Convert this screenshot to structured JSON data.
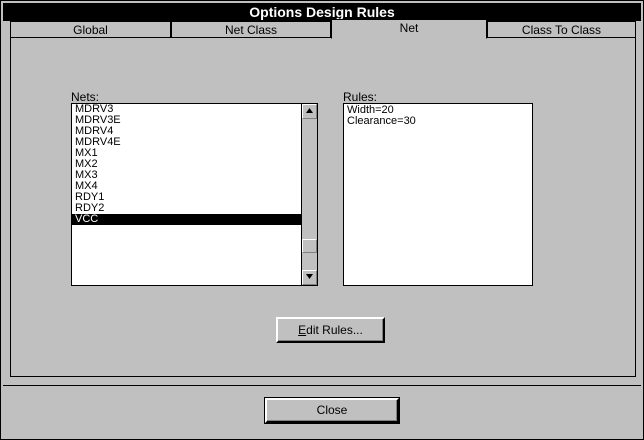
{
  "window": {
    "title": "Options Design Rules"
  },
  "tabs": [
    {
      "label": "Global",
      "active": false
    },
    {
      "label": "Net Class",
      "active": false
    },
    {
      "label": "Net",
      "active": true
    },
    {
      "label": "Class To Class",
      "active": false
    }
  ],
  "nets": {
    "label": "Nets:",
    "items": [
      "MDRV3",
      "MDRV3E",
      "MDRV4",
      "MDRV4E",
      "MX1",
      "MX2",
      "MX3",
      "MX4",
      "RDY1",
      "RDY2",
      "VCC"
    ],
    "selected": "VCC"
  },
  "rules": {
    "label": "Rules:",
    "items": [
      "Width=20",
      "Clearance=30"
    ]
  },
  "buttons": {
    "edit_rules_accel": "E",
    "edit_rules_rest": "dit Rules...",
    "close": "Close"
  },
  "icons": {
    "scroll_up": "arrow-up-icon",
    "scroll_down": "arrow-down-icon"
  }
}
